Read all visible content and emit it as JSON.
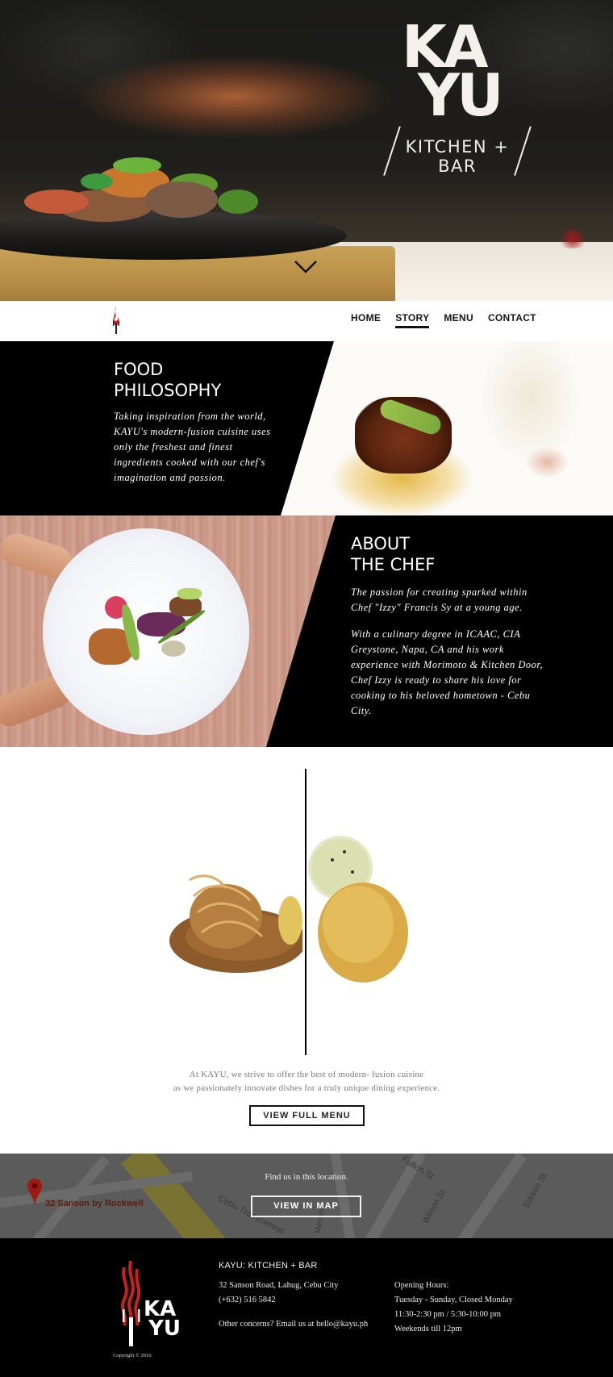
{
  "brand": {
    "logo_top": "KA",
    "logo_bottom": "YU",
    "tagline": "KITCHEN + BAR"
  },
  "nav": {
    "items": [
      {
        "label": "HOME",
        "active": false
      },
      {
        "label": "STORY",
        "active": true
      },
      {
        "label": "MENU",
        "active": false
      },
      {
        "label": "CONTACT",
        "active": false
      }
    ]
  },
  "food_philosophy": {
    "title_line1": "FOOD",
    "title_line2": "PHILOSOPHY",
    "body": [
      "Taking inspiration from the world,",
      "KAYU's modern-fusion cuisine uses",
      "only the freshest and finest",
      "ingredients cooked with our chef's",
      "imagination and passion."
    ]
  },
  "about_chef": {
    "title_line1": "ABOUT",
    "title_line2": "THE CHEF",
    "para1": [
      "The passion for creating sparked within",
      "Chef \"Izzy\" Francis Sy at a young age."
    ],
    "para2": [
      "With a culinary degree in ICAAC, CIA",
      "Greystone, Napa, CA and his work",
      "experience with Morimoto & Kitchen Door,",
      "Chef Izzy is ready to share his love for",
      "cooking to his beloved hometown - Cebu",
      "City."
    ]
  },
  "menu_teaser": {
    "line1": "At KAYU, we strive to offer the best of modern- fusion cuisine",
    "line2": "as we passionately innovate dishes for a truly unique dining experience.",
    "button": "VIEW FULL MENU"
  },
  "map": {
    "find_text": "Find us in this location.",
    "button": "VIEW IN MAP",
    "place_label": "32 Sanson by Rockwell",
    "street_labels": [
      "Fulton St",
      "Wilson St",
      "Edison St",
      "Cebu Transcentral",
      "Marconi"
    ]
  },
  "footer": {
    "title": "KAYU: KITCHEN + BAR",
    "address": "32 Sanson Road, Lahug, Cebu City",
    "phone": "(+632) 516 5842",
    "concerns": "Other concerns? Email us at hello@kayu.ph",
    "hours_label": "Opening Hours:",
    "hours_days": "Tuesday - Sunday, Closed Monday",
    "hours_times": "11:30-2:30 pm / 5:30-10:00 pm",
    "hours_weekend": "Weekends till 12pm",
    "copyright": "Copyright © 2016",
    "logo_top": "KA",
    "logo_bottom": "YU"
  },
  "colors": {
    "black": "#000000",
    "white": "#ffffff",
    "map_gray": "#5b5b5b",
    "logo_red": "#c8211f"
  },
  "icons": [
    "chevron-down-icon",
    "fork-flame-icon",
    "map-pin-icon"
  ]
}
